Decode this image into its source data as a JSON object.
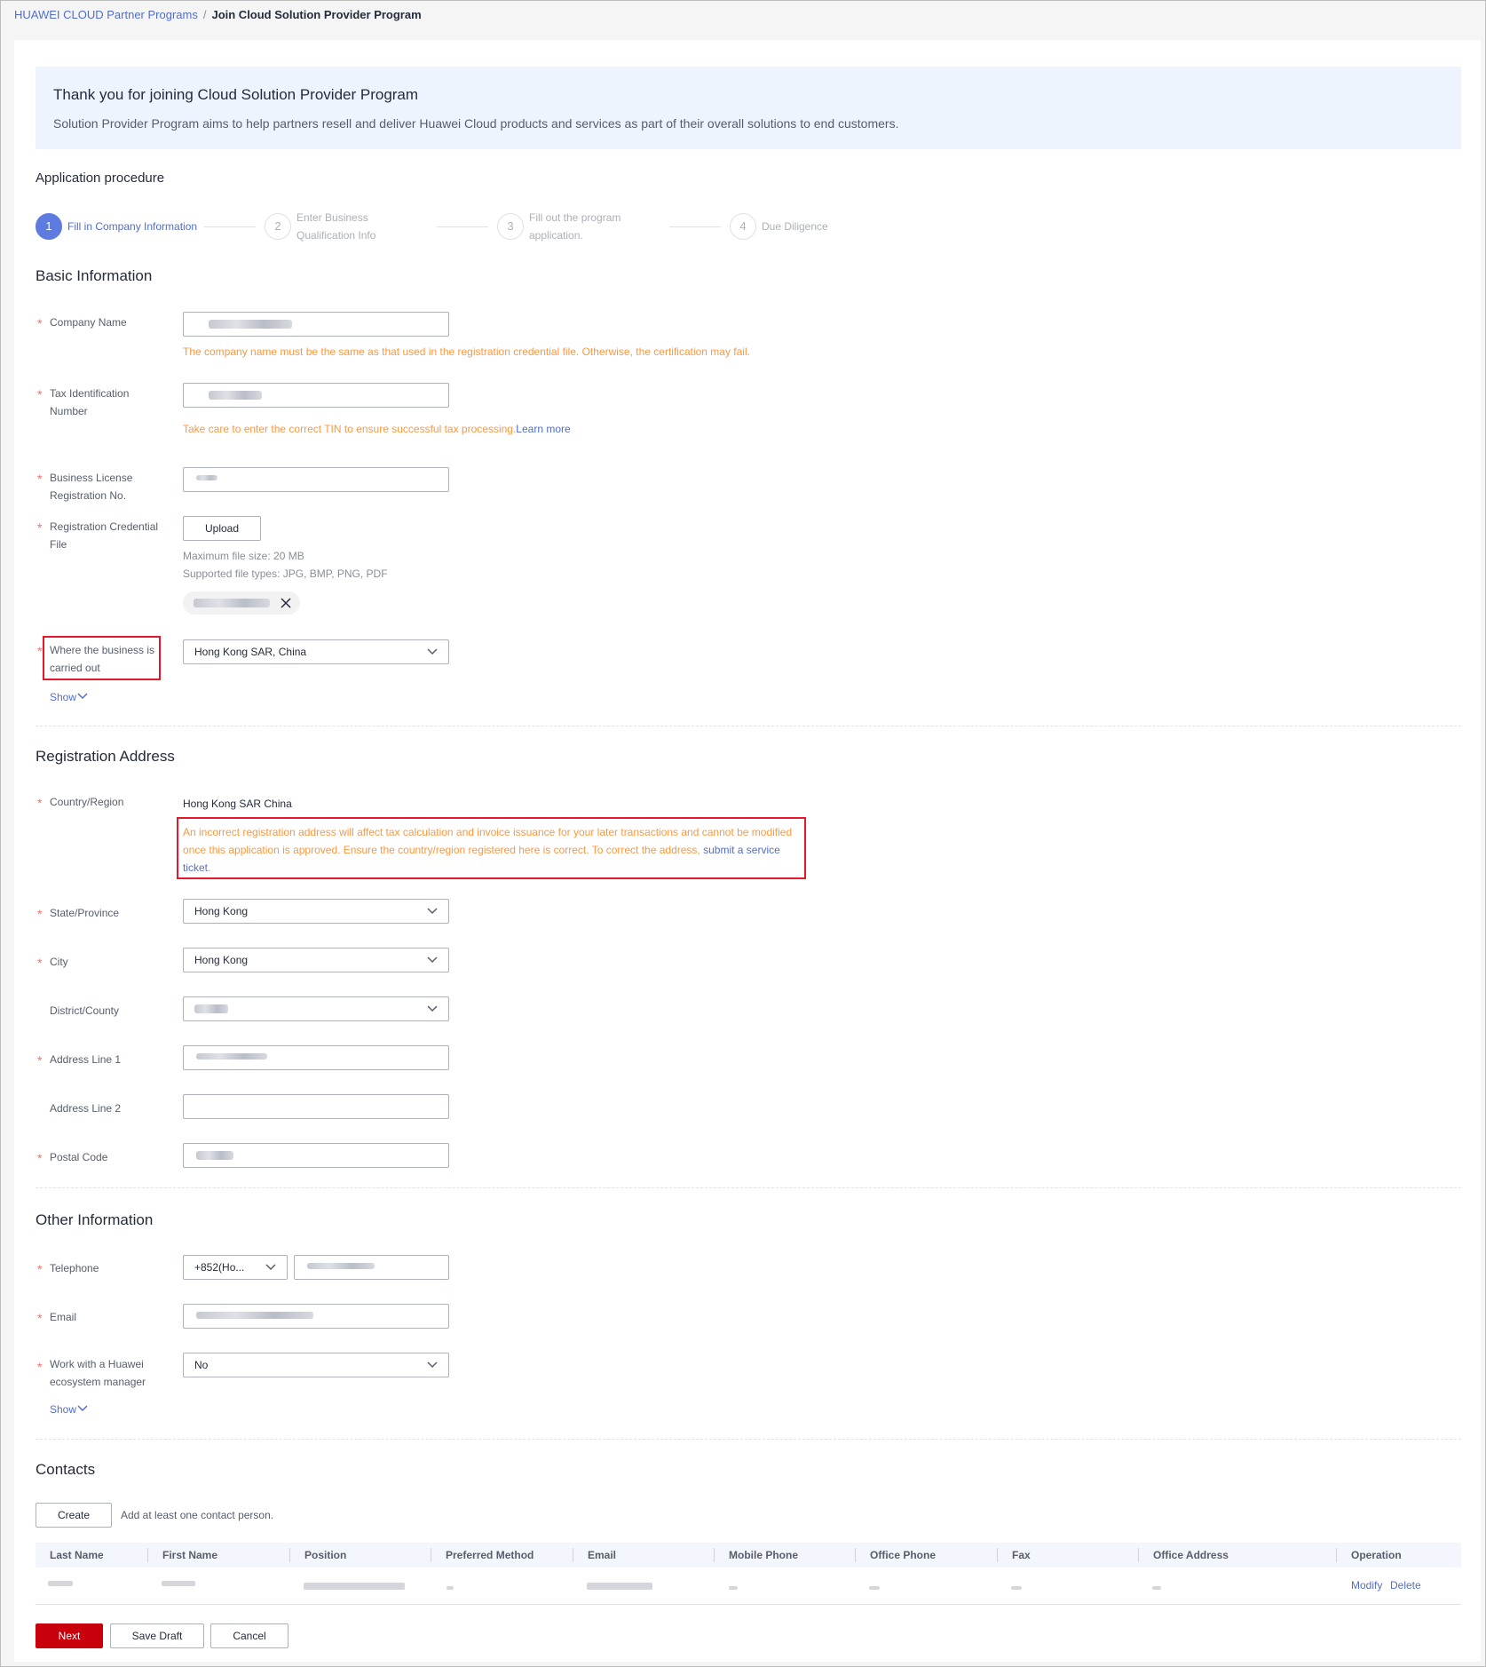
{
  "breadcrumb": {
    "parent": "HUAWEI CLOUD Partner Programs",
    "separator": "/",
    "current": "Join Cloud Solution Provider Program"
  },
  "banner": {
    "title": "Thank you for joining Cloud Solution Provider Program",
    "description": "Solution Provider Program aims to help partners resell and deliver Huawei Cloud products and services as part of their overall solutions to end customers."
  },
  "procedure": {
    "title": "Application procedure",
    "current_step": 1,
    "steps": [
      {
        "number": "1",
        "label_line1": "Fill in Company Information",
        "label_line2": ""
      },
      {
        "number": "2",
        "label_line1": "Enter Business",
        "label_line2": "Qualification Info"
      },
      {
        "number": "3",
        "label_line1": "Fill out the program",
        "label_line2": "application."
      },
      {
        "number": "4",
        "label_line1": "Due Diligence",
        "label_line2": ""
      }
    ]
  },
  "basic_info": {
    "title": "Basic Information",
    "company_name": {
      "label": "Company Name",
      "hint": "The company name must be the same as that used in the registration credential file. Otherwise, the certification may fail."
    },
    "tin": {
      "label_line1": "Tax Identification",
      "label_line2": "Number",
      "hint": "Take care to enter the correct TIN to ensure successful tax processing.",
      "hint_link": "Learn more"
    },
    "business_license": {
      "label_line1": "Business License",
      "label_line2": "Registration No."
    },
    "credential_file": {
      "label_line1": "Registration Credential",
      "label_line2": "File",
      "upload_label": "Upload",
      "max_size": "Maximum file size: 20 MB",
      "file_types": "Supported file types: JPG, BMP, PNG, PDF",
      "remove_icon": "close-icon"
    },
    "business_location": {
      "label_line1": "Where the business is",
      "label_line2": "carried out",
      "value": "Hong Kong SAR, China"
    },
    "show_label": "Show"
  },
  "registration_address": {
    "title": "Registration Address",
    "country": {
      "label": "Country/Region",
      "value": "Hong Kong SAR China",
      "warning_line1": "An incorrect registration address will affect tax calculation and invoice issuance for your later transactions and cannot be modified",
      "warning_line2": "once this application is approved. Ensure the country/region registered here is correct. To correct the address,",
      "warning_link_part1": "submit a service",
      "warning_link_part2": "ticket",
      "warning_end": "."
    },
    "state": {
      "label": "State/Province",
      "value": "Hong Kong"
    },
    "city": {
      "label": "City",
      "value": "Hong Kong"
    },
    "district": {
      "label": "District/County"
    },
    "address1": {
      "label": "Address Line 1"
    },
    "address2": {
      "label": "Address Line 2"
    },
    "postal": {
      "label": "Postal Code"
    }
  },
  "other_info": {
    "title": "Other Information",
    "telephone": {
      "label": "Telephone",
      "country_code": "+852(Ho..."
    },
    "email": {
      "label": "Email"
    },
    "ecosystem_manager": {
      "label_line1": "Work with a Huawei",
      "label_line2": "ecosystem manager",
      "value": "No"
    },
    "show_label": "Show"
  },
  "contacts": {
    "title": "Contacts",
    "create_label": "Create",
    "hint": "Add at least one contact person.",
    "columns": [
      "Last Name",
      "First Name",
      "Position",
      "Preferred Method",
      "Email",
      "Mobile Phone",
      "Office Phone",
      "Fax",
      "Office Address",
      "Operation"
    ],
    "row_actions": {
      "modify": "Modify",
      "delete": "Delete"
    }
  },
  "footer": {
    "next_label": "Next",
    "save_draft_label": "Save Draft",
    "cancel_label": "Cancel"
  },
  "colors": {
    "brand_red": "#c7000b",
    "link_blue": "#526ecc",
    "warning_orange": "#fa9841",
    "required_star": "#f66f6a",
    "annotation_red": "#e6172a"
  }
}
